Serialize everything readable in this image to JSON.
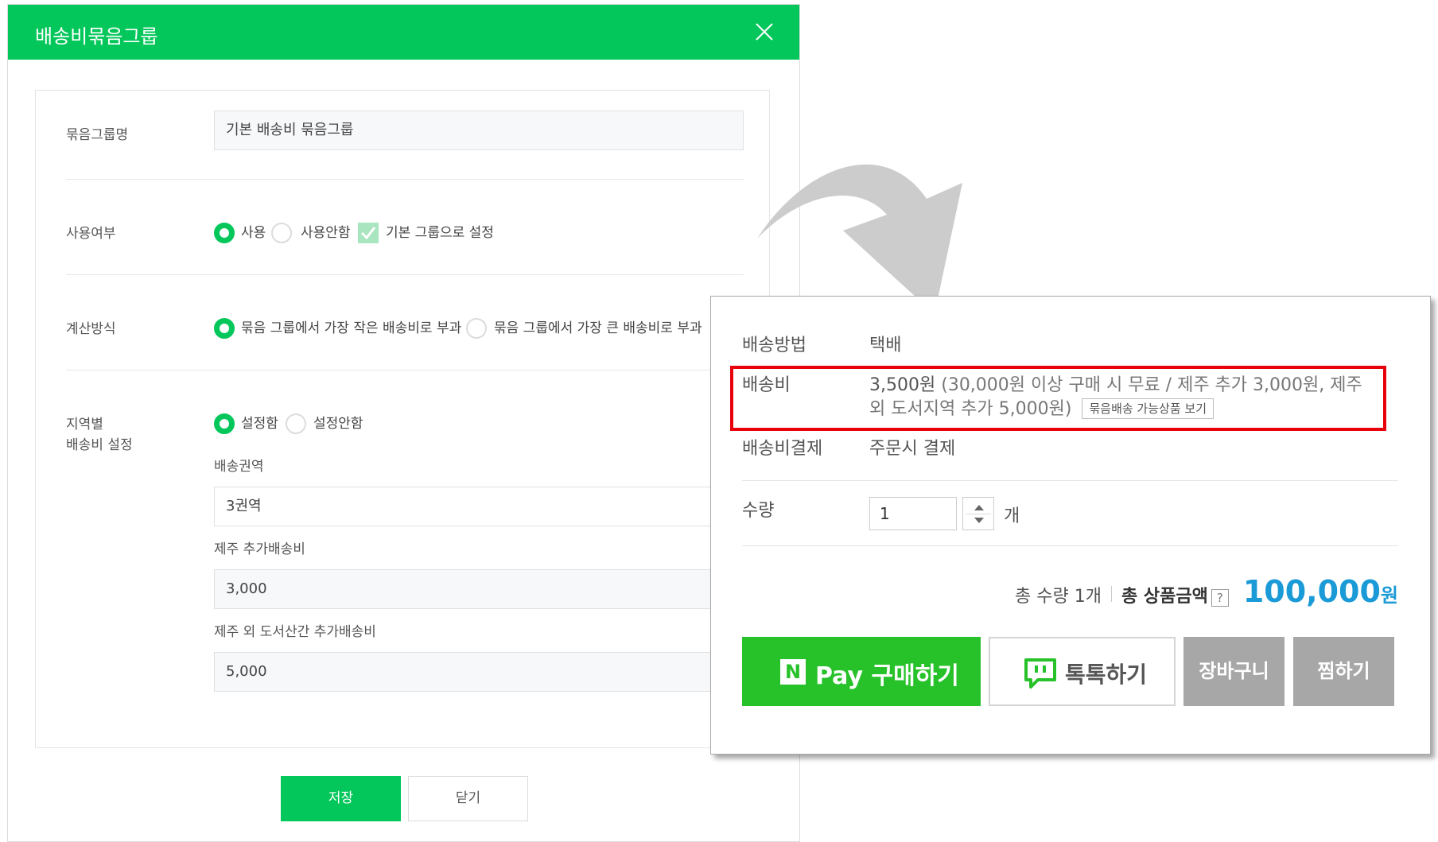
{
  "modal": {
    "title": "배송비묶음그룹",
    "close_icon": "close-icon",
    "group_name_label": "묶음그룹명",
    "group_name_value": "기본 배송비 묶음그룹",
    "usage_label": "사용여부",
    "usage_options": [
      "사용",
      "사용안함"
    ],
    "usage_selected": "사용",
    "default_group_checkbox_label": "기본 그룹으로 설정",
    "default_group_checked": true,
    "calc_label": "계산방식",
    "calc_options": [
      "묶음 그룹에서 가장 작은 배송비로 부과",
      "묶음 그룹에서 가장 큰 배송비로 부과"
    ],
    "calc_selected": "묶음 그룹에서 가장 작은 배송비로 부과",
    "region_label_line1": "지역별",
    "region_label_line2": "배송비 설정",
    "region_options": [
      "설정함",
      "설정안함"
    ],
    "region_selected": "설정함",
    "zone_label": "배송권역",
    "zone_value": "3권역",
    "jeju_label": "제주 추가배송비",
    "jeju_value": "3,000",
    "island_label": "제주 외 도서산간 추가배송비",
    "island_value": "5,000",
    "save_label": "저장",
    "close_label": "닫기",
    "accent_color": "#03c75a"
  },
  "product": {
    "ship_method_label": "배송방법",
    "ship_method_value": "택배",
    "ship_fee_label": "배송비",
    "ship_fee_amount": "3,500원",
    "ship_fee_note_line1": "(30,000원 이상 구매 시 무료 / 제주 추가 3,000원, 제주",
    "ship_fee_note_line2": "외 도서지역 추가 5,000원)",
    "bundle_link": "묶음배송 가능상품 보기",
    "ship_pay_label": "배송비결제",
    "ship_pay_value": "주문시 결제",
    "qty_label": "수량",
    "qty_value": "1",
    "qty_unit": "개",
    "total_qty": "총 수량 1개",
    "total_label": "총 상품금액",
    "help": "?",
    "total_price": "100,000",
    "currency": "원",
    "npay_badge": "N",
    "npay_label": "Pay 구매하기",
    "talk_label": "톡톡하기",
    "cart_label": "장바구니",
    "wish_label": "찜하기",
    "highlight_color": "#e8000b",
    "price_color": "#1a9ad6",
    "npay_color": "#27c22a"
  }
}
